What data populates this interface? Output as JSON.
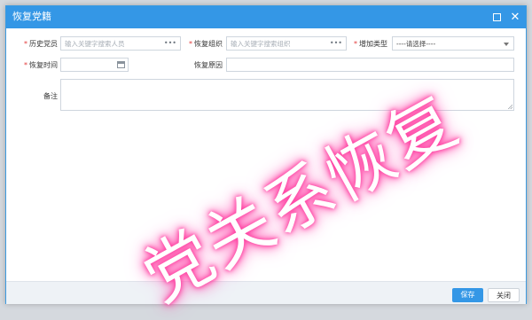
{
  "dialog": {
    "title": "恢复党籍"
  },
  "form": {
    "history_member": {
      "label": "历史党员",
      "required": true,
      "placeholder": "输入关键字搜索人员"
    },
    "restore_org": {
      "label": "恢复组织",
      "required": true,
      "placeholder": "输入关键字搜索组织"
    },
    "add_type": {
      "label": "增加类型",
      "required": true,
      "value": "----请选择----"
    },
    "restore_time": {
      "label": "恢复时间",
      "required": true,
      "value": ""
    },
    "restore_reason": {
      "label": "恢复原因",
      "required": false,
      "value": ""
    },
    "remark": {
      "label": "备注",
      "required": false,
      "value": ""
    },
    "required_mark": "*",
    "lookup_glyph": "•••"
  },
  "footer": {
    "save_label": "保存",
    "close_label": "关闭"
  },
  "watermark": {
    "text": "党关系恢复"
  },
  "colors": {
    "accent": "#3497e6",
    "required": "#e23b3b",
    "watermark_glow": "#ff3fa0"
  },
  "icons": {
    "maximize": "maximize-icon",
    "close": "close-icon",
    "calendar": "calendar-icon"
  }
}
